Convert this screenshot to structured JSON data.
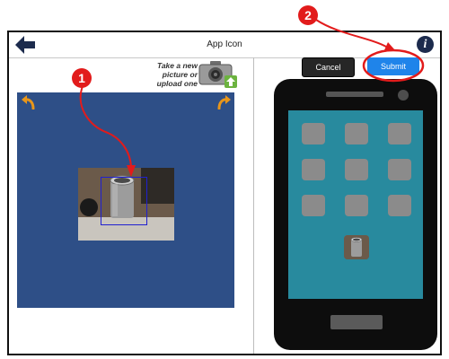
{
  "header": {
    "title": "App Icon",
    "back_icon": "back-arrow-icon",
    "info_icon": "info-icon",
    "info_label": "i"
  },
  "upload": {
    "prompt": "Take a new picture or upload one",
    "icon": "camera-icon"
  },
  "editor": {
    "rotate_left_icon": "rotate-left-icon",
    "rotate_right_icon": "rotate-right-icon",
    "background_color": "#2e4f87"
  },
  "actions": {
    "cancel_label": "Cancel",
    "submit_label": "Submit"
  },
  "phone_preview": {
    "screen_color": "#288a9e",
    "tile_color": "#8b8b8b"
  },
  "annotations": {
    "marker_1": "1",
    "marker_2": "2",
    "color": "#e21b1b"
  }
}
